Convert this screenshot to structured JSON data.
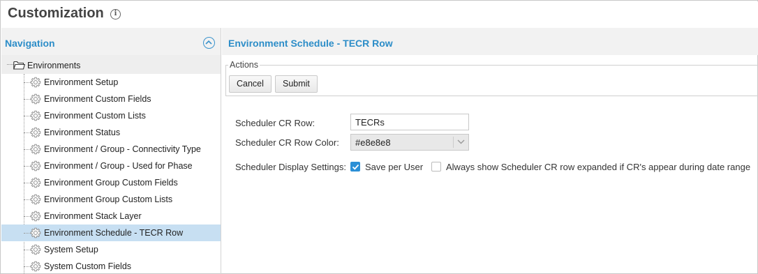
{
  "page": {
    "title": "Customization",
    "info_icon": "info-icon"
  },
  "navigation": {
    "title": "Navigation",
    "collapse_icon": "chevron-up-icon",
    "root": {
      "label": "Environments",
      "icon": "folder-icon"
    },
    "items": [
      {
        "label": "Environment Setup",
        "icon": "gear-icon"
      },
      {
        "label": "Environment Custom Fields",
        "icon": "gear-icon"
      },
      {
        "label": "Environment Custom Lists",
        "icon": "gear-icon"
      },
      {
        "label": "Environment Status",
        "icon": "gear-icon"
      },
      {
        "label": "Environment / Group - Connectivity Type",
        "icon": "gear-icon"
      },
      {
        "label": "Environment / Group - Used for Phase",
        "icon": "gear-icon"
      },
      {
        "label": "Environment Group Custom Fields",
        "icon": "gear-icon"
      },
      {
        "label": "Environment Group Custom Lists",
        "icon": "gear-icon"
      },
      {
        "label": "Environment Stack Layer",
        "icon": "gear-icon"
      },
      {
        "label": "Environment Schedule - TECR Row",
        "icon": "gear-icon",
        "selected": true
      },
      {
        "label": "System Setup",
        "icon": "gear-icon"
      },
      {
        "label": "System Custom Fields",
        "icon": "gear-icon"
      }
    ]
  },
  "main": {
    "title": "Environment Schedule - TECR Row",
    "actions": {
      "legend": "Actions",
      "cancel_label": "Cancel",
      "submit_label": "Submit"
    },
    "form": {
      "cr_row_label": "Scheduler CR Row:",
      "cr_row_value": "TECRs",
      "cr_row_color_label": "Scheduler CR Row Color:",
      "cr_row_color_value": "#e8e8e8",
      "display_settings_label": "Scheduler Display Settings:",
      "save_per_user_label": "Save per User",
      "save_per_user_checked": true,
      "always_show_label": "Always show Scheduler CR row expanded if CR's appear during date range",
      "always_show_checked": false
    }
  },
  "colors": {
    "accent": "#2c8dc8",
    "selected_row": "#c7dff2",
    "header_bg": "#f2f2f2",
    "checkbox_checked": "#2b8fd6"
  }
}
